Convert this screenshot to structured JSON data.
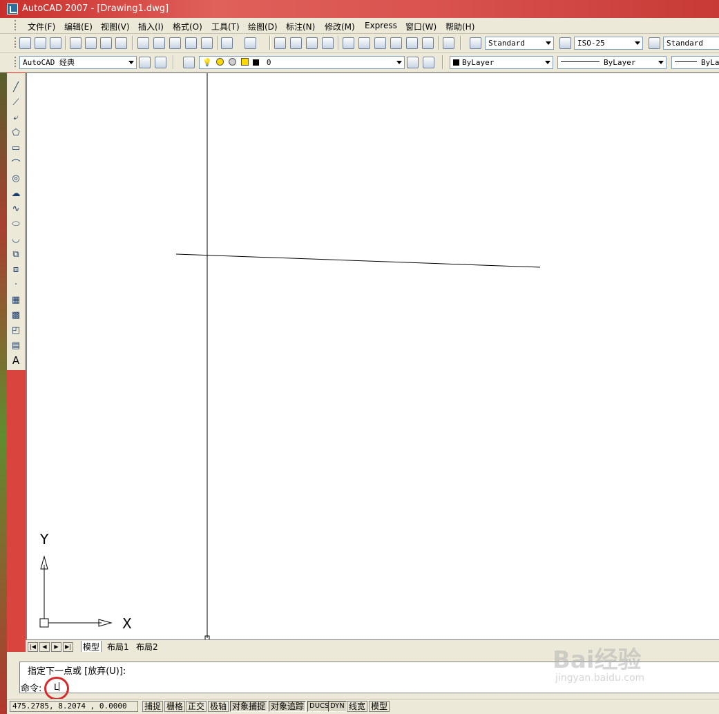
{
  "window": {
    "title": "AutoCAD 2007 - [Drawing1.dwg]"
  },
  "menubar": {
    "items": [
      "文件(F)",
      "编辑(E)",
      "视图(V)",
      "插入(I)",
      "格式(O)",
      "工具(T)",
      "绘图(D)",
      "标注(N)",
      "修改(M)",
      "Express",
      "窗口(W)",
      "帮助(H)"
    ]
  },
  "toolbar_styles": {
    "text_style": "Standard",
    "dim_style": "ISO-25",
    "table_style": "Standard"
  },
  "toolbar_layers": {
    "workspace": "AutoCAD 经典",
    "layer": "0",
    "color": "ByLayer",
    "linetype": "ByLayer",
    "lineweight": "ByLa"
  },
  "ucs": {
    "x_label": "X",
    "y_label": "Y"
  },
  "layout_tabs": [
    "模型",
    "布局1",
    "布局2"
  ],
  "command": {
    "prompt_line": "指定下一点或 [放弃(U)]:",
    "command_label": "命令:",
    "input_value": "L"
  },
  "status": {
    "coordinates": "475.2785,  8.2074  , 0.0000",
    "toggles": [
      "捕捉",
      "栅格",
      "正交",
      "极轴",
      "对象捕捉",
      "对象追踪",
      "DUCS",
      "DYN",
      "线宽",
      "模型"
    ]
  },
  "watermark": {
    "line1": "Bai经验",
    "line2": "jingyan.baidu.com"
  },
  "icons": {
    "draw_tools": [
      "line-icon",
      "construction-line-icon",
      "polyline-icon",
      "polygon-icon",
      "rectangle-icon",
      "arc-icon",
      "circle-icon",
      "revision-cloud-icon",
      "spline-icon",
      "ellipse-icon",
      "ellipse-arc-icon",
      "insert-block-icon",
      "make-block-icon",
      "point-icon",
      "hatch-icon",
      "gradient-icon",
      "region-icon",
      "table-icon",
      "multiline-text-icon"
    ]
  }
}
